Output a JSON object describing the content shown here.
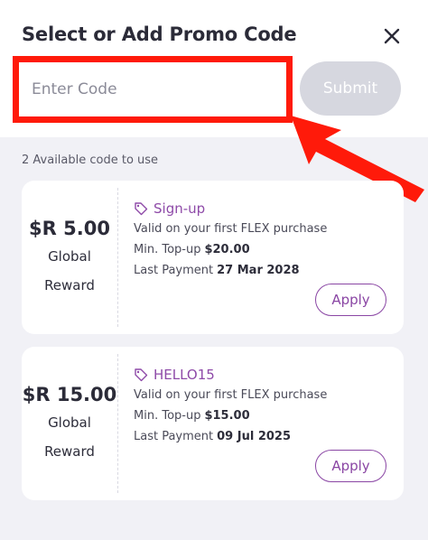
{
  "header": {
    "title": "Select or Add Promo Code",
    "close_icon": "close-icon"
  },
  "promo_input": {
    "placeholder": "Enter Code",
    "value": ""
  },
  "submit_label": "Submit",
  "available_text": "2 Available code to use",
  "colors": {
    "highlight_red": "#ff1a0a",
    "accent_purple": "#8a46a4",
    "submit_disabled": "#d6d7df"
  },
  "promos": [
    {
      "amount": "$R 5.00",
      "reward_line1": "Global",
      "reward_line2": "Reward",
      "code": "Sign-up",
      "description": "Valid on your first FLEX purchase",
      "min_label": "Min. Top-up",
      "min_value": "$20.00",
      "last_label": "Last Payment",
      "last_value": "27 Mar 2028",
      "apply_label": "Apply"
    },
    {
      "amount": "$R 15.00",
      "reward_line1": "Global",
      "reward_line2": "Reward",
      "code": "HELLO15",
      "description": "Valid on your first FLEX purchase",
      "min_label": "Min. Top-up",
      "min_value": "$15.00",
      "last_label": "Last Payment",
      "last_value": "09 Jul 2025",
      "apply_label": "Apply"
    }
  ]
}
